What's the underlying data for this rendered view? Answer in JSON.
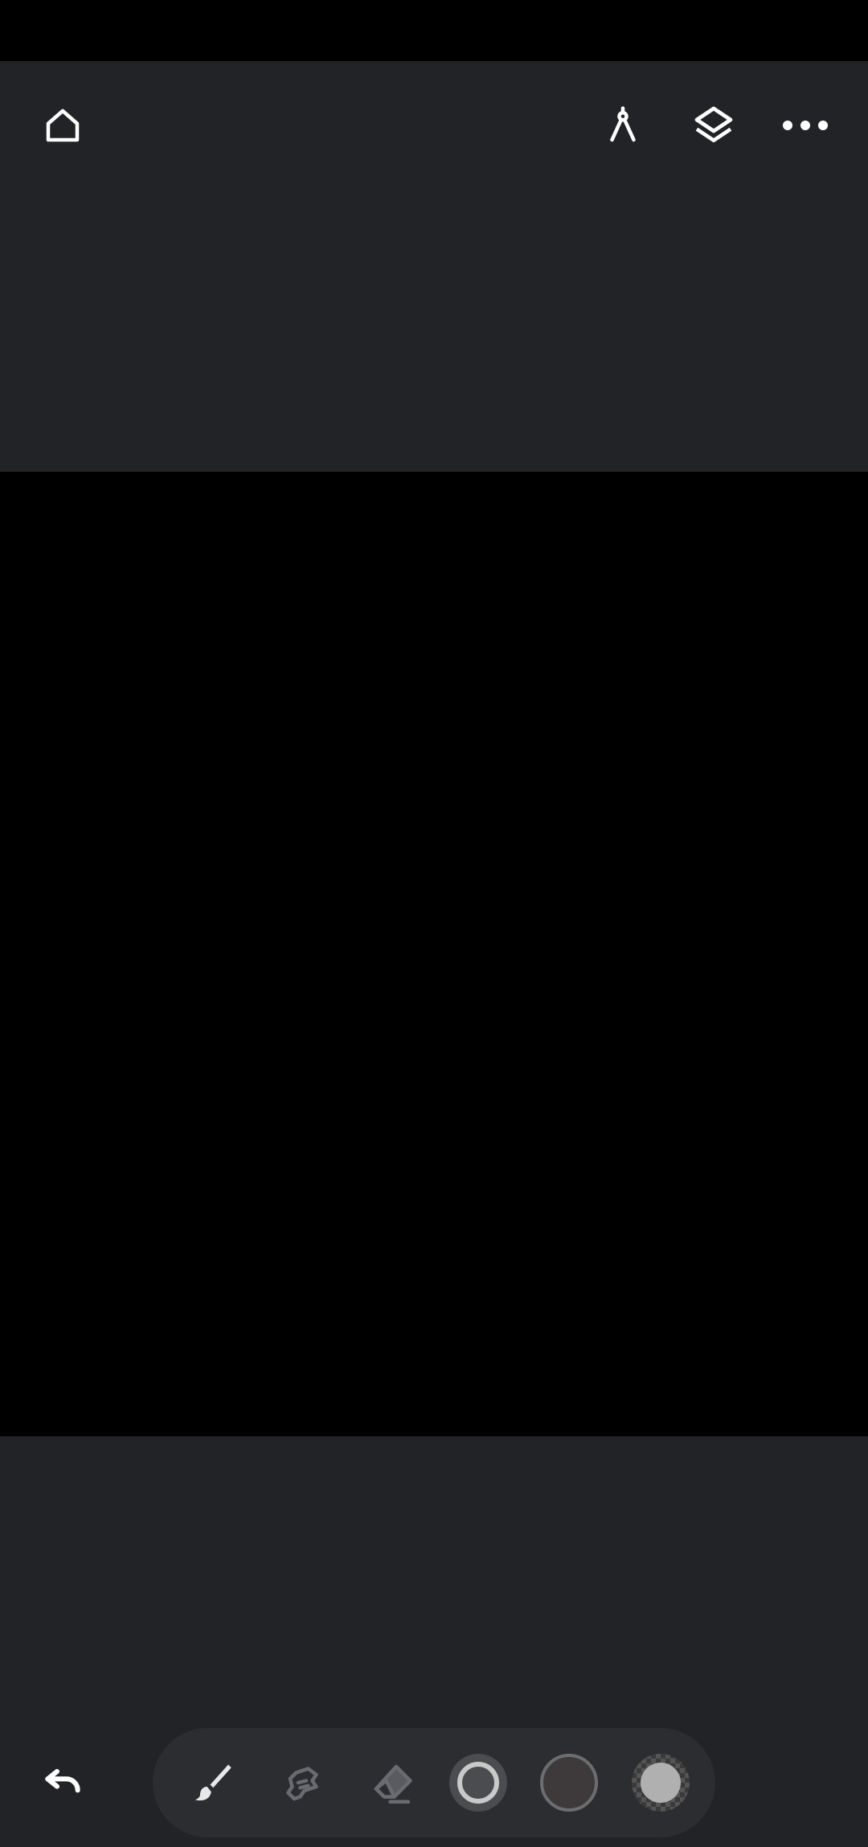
{
  "top_bar": {
    "home_icon": "home-icon",
    "ruler_icon": "compass-icon",
    "layers_icon": "layers-icon",
    "more_icon": "more-horizontal-icon"
  },
  "bottom_bar": {
    "undo_icon": "undo-icon",
    "tools": [
      {
        "name": "brush",
        "icon": "brush-icon",
        "active": true
      },
      {
        "name": "smudge",
        "icon": "smudge-icon",
        "active": false
      },
      {
        "name": "eraser",
        "icon": "eraser-icon",
        "active": false
      }
    ],
    "brush_size_swatch": {
      "color": "#c9c9c9"
    },
    "color_swatch": {
      "color": "#3e3a3b"
    },
    "opacity_swatch": {
      "color": "#b0b0b0"
    }
  },
  "colors": {
    "background": "#222326",
    "canvas": "#000000",
    "toolbar_bg": "#2c2d31",
    "icon_active": "#ffffff",
    "icon_inactive": "#6a6b70"
  }
}
